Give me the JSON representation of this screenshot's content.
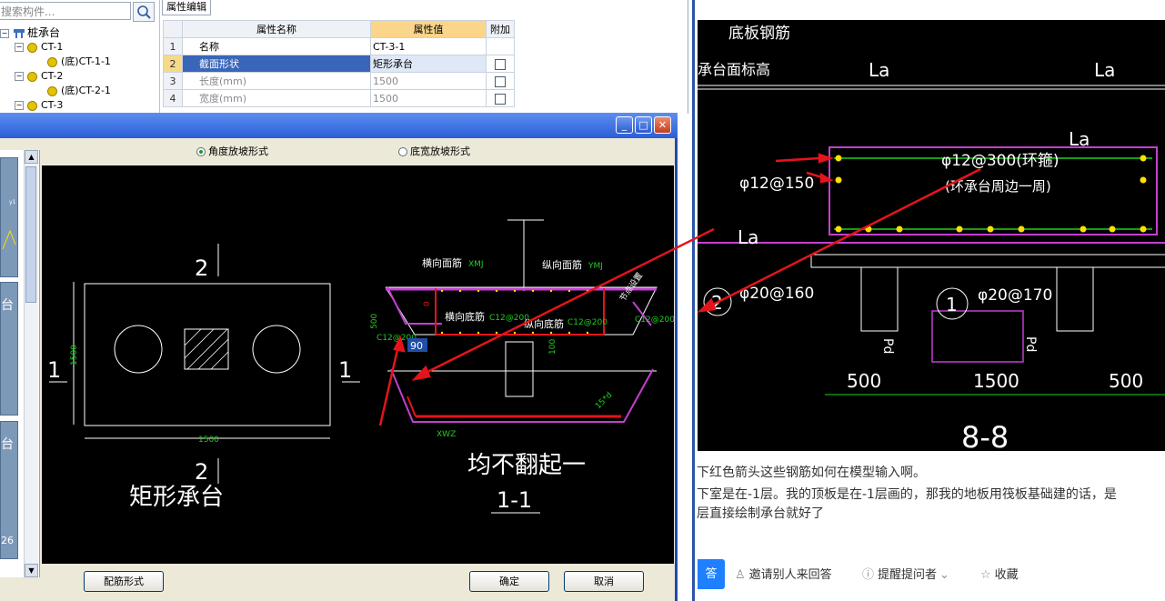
{
  "tree": {
    "search_placeholder": "搜索构件...",
    "items": [
      {
        "toggle": "−",
        "label": "桩承台",
        "kind": "root"
      },
      {
        "toggle": "−",
        "label": "CT-1",
        "kind": "group"
      },
      {
        "toggle": "",
        "label": "(底)CT-1-1",
        "kind": "leaf"
      },
      {
        "toggle": "−",
        "label": "CT-2",
        "kind": "group"
      },
      {
        "toggle": "",
        "label": "(底)CT-2-1",
        "kind": "leaf"
      },
      {
        "toggle": "−",
        "label": "CT-3",
        "kind": "group"
      }
    ]
  },
  "props": {
    "tab": "属性编辑",
    "headers": {
      "name": "属性名称",
      "value": "属性值",
      "extra": "附加"
    },
    "rows": [
      {
        "idx": "1",
        "name": "名称",
        "value": "CT-3-1",
        "checkbox": false
      },
      {
        "idx": "2",
        "name": "截面形状",
        "value": "矩形承台",
        "checkbox": true
      },
      {
        "idx": "3",
        "name": "长度(mm)",
        "value": "1500",
        "checkbox": true
      },
      {
        "idx": "4",
        "name": "宽度(mm)",
        "value": "1500",
        "checkbox": true
      }
    ]
  },
  "dialog": {
    "window_buttons": {
      "minimize": "_",
      "maximize": "□",
      "close": "✕"
    },
    "radios": [
      {
        "label": "角度放坡形式",
        "selected": true
      },
      {
        "label": "底宽放坡形式",
        "selected": false
      }
    ],
    "sidebar_labels": [
      "台",
      "台",
      "26"
    ],
    "buttons": {
      "rebar": "配筋形式",
      "ok": "确定",
      "cancel": "取消"
    },
    "drawing": {
      "plan_label_top": "2",
      "plan_label_bottom": "2",
      "plan_label_left": "1",
      "plan_label_right": "1",
      "plan_dim_width": "1500",
      "plan_dim_height": "1500",
      "plan_title": "矩形承台",
      "section_title": "1-1",
      "annotation": "均不翻起一",
      "bar_top_transverse": "横向面筋",
      "bar_top_transverse_code": "XMJ",
      "bar_top_long": "纵向面筋",
      "bar_top_long_code": "YMJ",
      "bar_bottom_transverse": "横向底筋",
      "bar_bottom_transverse_spec": "C12@200",
      "bar_bottom_long": "纵向底筋",
      "bar_bottom_long_spec": "C12@200",
      "side_spec_left": "C12@200",
      "side_spec_right": "C12@200",
      "side_bar": "节点设置",
      "height_dim": "500",
      "small_dim": "0",
      "angle_value": "90",
      "bottom_dim": "100",
      "hook": "15*d",
      "code_xwz": "XWZ"
    }
  },
  "right": {
    "cad": {
      "labels": [
        "底板钢筋",
        "承台面标高",
        "La",
        "La",
        "La",
        "La",
        "φ12@150",
        "φ12@300(环箍)",
        "(环承台周边一周)",
        "φ20@160",
        "φ20@170",
        "500",
        "1500",
        "500",
        "8-8",
        "2",
        "1",
        "Pd",
        "Pd"
      ]
    },
    "question_lines": [
      "下红色箭头这些钢筋如何在模型输入啊。",
      "下室是在-1层。我的顶板是在-1层画的，那我的地板用筏板基础建的话，是",
      "层直接绘制承台就好了"
    ],
    "answer_btn": "答",
    "actions": [
      {
        "icon": "person-icon",
        "glyph": "♙",
        "label": "邀请别人来回答"
      },
      {
        "icon": "info-icon",
        "glyph": "ⓘ",
        "label": "提醒提问者"
      },
      {
        "icon": "star-icon",
        "glyph": "☆",
        "label": "收藏"
      }
    ],
    "colors": {
      "accent": "#1e80ff",
      "cad_green": "#1fd01f",
      "cad_magenta": "#c33fd0",
      "arrow_red": "#e4141b"
    }
  }
}
